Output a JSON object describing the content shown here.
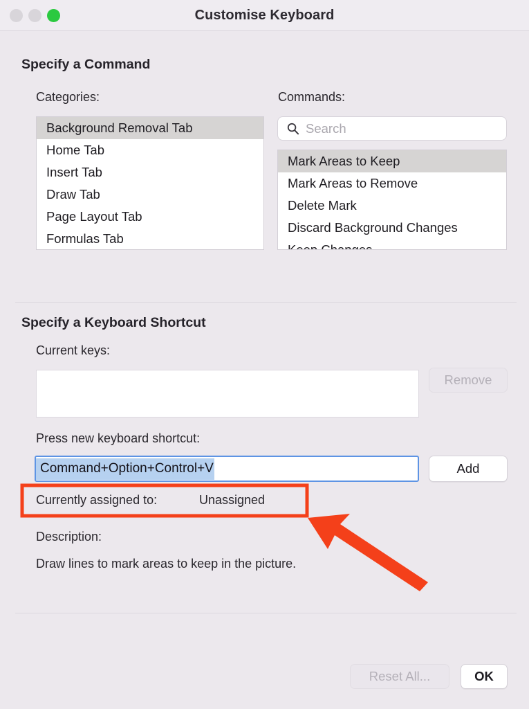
{
  "window": {
    "title": "Customise Keyboard",
    "controls": [
      {
        "name": "close",
        "label": "Close",
        "color": "#d8d5da"
      },
      {
        "name": "minimize",
        "label": "Minimise",
        "color": "#d8d5da"
      },
      {
        "name": "zoom",
        "label": "Zoom",
        "color": "#2bc940"
      }
    ]
  },
  "command_section": {
    "heading": "Specify a Command",
    "categories_label": "Categories:",
    "categories": [
      {
        "label": "Background Removal Tab",
        "selected": true
      },
      {
        "label": "Home Tab",
        "selected": false
      },
      {
        "label": "Insert Tab",
        "selected": false
      },
      {
        "label": "Draw Tab",
        "selected": false
      },
      {
        "label": "Page Layout Tab",
        "selected": false
      },
      {
        "label": "Formulas Tab",
        "selected": false
      }
    ],
    "commands_label": "Commands:",
    "search": {
      "placeholder": "Search",
      "value": "",
      "icon": "search-icon"
    },
    "commands": [
      {
        "label": "Mark Areas to Keep",
        "selected": true
      },
      {
        "label": "Mark Areas to Remove",
        "selected": false
      },
      {
        "label": "Delete Mark",
        "selected": false
      },
      {
        "label": "Discard Background Changes",
        "selected": false
      },
      {
        "label": "Keep Changes",
        "selected": false
      }
    ]
  },
  "shortcut_section": {
    "heading": "Specify a Keyboard Shortcut",
    "current_keys_label": "Current keys:",
    "current_keys_value": "",
    "remove_button": "Remove",
    "press_new_label": "Press new keyboard shortcut:",
    "shortcut_value": "Command+Option+Control+V",
    "add_button": "Add",
    "assigned_label": "Currently assigned to:",
    "assigned_value": "Unassigned",
    "description_label": "Description:",
    "description_text": "Draw lines to mark areas to keep in the picture."
  },
  "footer": {
    "reset_button": "Reset All...",
    "ok_button": "OK"
  },
  "annotations": {
    "highlight_color": "#f4401a",
    "arrow_color": "#f4401a"
  }
}
